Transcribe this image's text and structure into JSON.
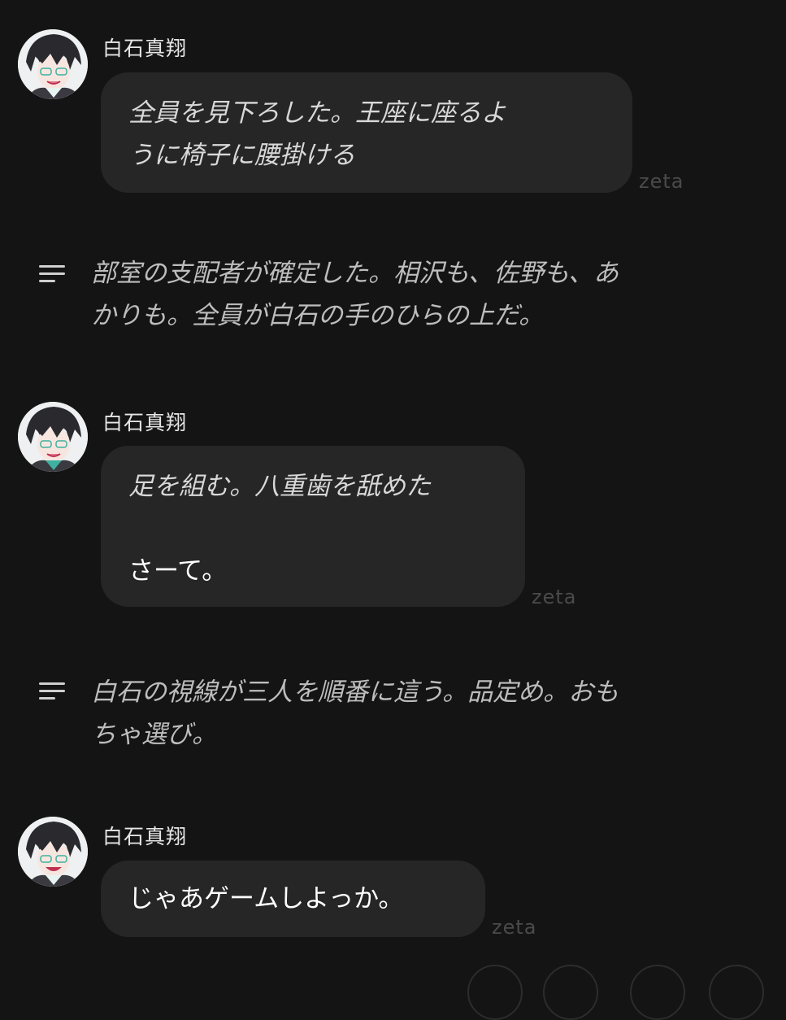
{
  "messages": [
    {
      "sender": "白石真翔",
      "action_lines": [
        "全員を見下ろした。王座に座るよ",
        "うに椅子に腰掛ける"
      ],
      "watermark": "zeta"
    },
    {
      "sender": "白石真翔",
      "action_lines": [
        "足を組む。八重歯を舐めた"
      ],
      "speech": "さーて。",
      "watermark": "zeta"
    },
    {
      "sender": "白石真翔",
      "speech": "じゃあゲームしよっか。",
      "watermark": "zeta"
    }
  ],
  "narrations": [
    {
      "lines": [
        "部室の支配者が確定した。相沢も、佐野も、あ",
        "かりも。全員が白石の手のひらの上だ。"
      ],
      "icon": "narration-lines-icon"
    },
    {
      "lines": [
        "白石の視線が三人を順番に這う。品定め。おも",
        "ちゃ選び。"
      ],
      "icon": "narration-lines-icon"
    }
  ],
  "colors": {
    "background": "#141414",
    "bubble": "#262626",
    "watermark": "#4a4a4a",
    "narration_text": "#bdbdbd"
  }
}
